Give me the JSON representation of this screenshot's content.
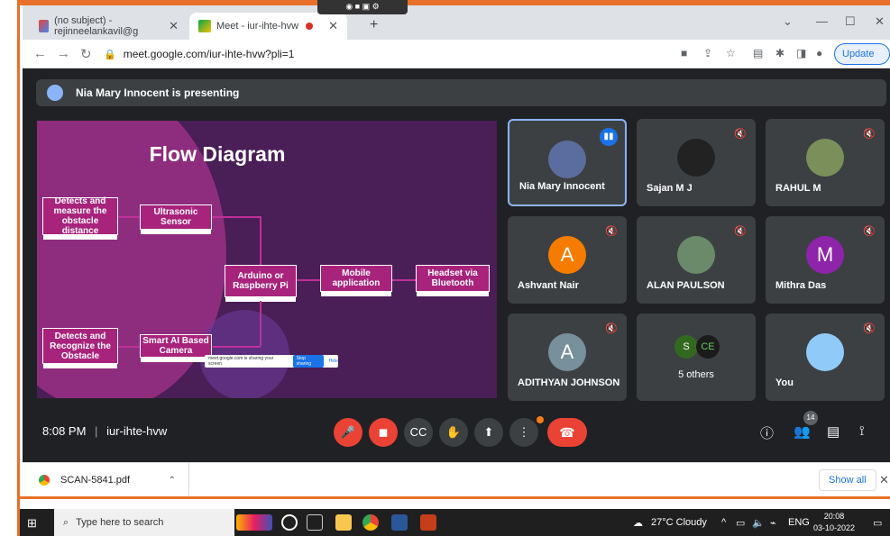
{
  "browser": {
    "tabs": [
      {
        "label": "(no subject) - rejinneelankavil@g"
      },
      {
        "label": "Meet - iur-ihte-hvw"
      }
    ],
    "new_tab": "+",
    "url": "meet.google.com/iur-ihte-hvw?pli=1",
    "update_label": "Update"
  },
  "meet": {
    "presenting_text": "Nia Mary Innocent is presenting",
    "slide": {
      "title": "Flow Diagram",
      "boxes": {
        "detect_measure": "Detects and measure the obstacle distance",
        "ultrasonic": "Ultrasonic Sensor",
        "arduino": "Arduino or Raspberry Pi",
        "mobile": "Mobile application",
        "headset": "Headset via Bluetooth",
        "detect_recognize": "Detects and Recognize the Obstacle",
        "smart_ai": "Smart AI Based Camera"
      },
      "share_tip": {
        "text": "meet.google.com is sharing your screen.",
        "stop": "Stop sharing",
        "hide": "Hide"
      }
    },
    "participants": [
      {
        "name": "Nia Mary Innocent"
      },
      {
        "name": "Sajan M J"
      },
      {
        "name": "RAHUL M"
      },
      {
        "name": "Ashvant Nair",
        "initial": "A"
      },
      {
        "name": "ALAN PAULSON"
      },
      {
        "name": "Mithra Das",
        "initial": "M"
      },
      {
        "name": "ADITHYAN JOHNSON",
        "initial": "A"
      },
      {
        "name": "5 others",
        "mini": [
          "S",
          "CE"
        ]
      },
      {
        "name": "You"
      }
    ],
    "time": "8:08 PM",
    "meeting_code": "iur-ihte-hvw",
    "participant_count": "14"
  },
  "downloads": {
    "file": "SCAN-5841.pdf",
    "show_all": "Show all"
  },
  "taskbar": {
    "search_placeholder": "Type here to search",
    "weather": "27°C  Cloudy",
    "lang": "ENG",
    "time": "20:08",
    "date": "03-10-2022"
  },
  "colors": {
    "meet_bg": "#202124",
    "accent": "#1a73e8",
    "red": "#ea4335",
    "slide_bg": "#4a1e56",
    "flow_box": "#a8237c"
  }
}
